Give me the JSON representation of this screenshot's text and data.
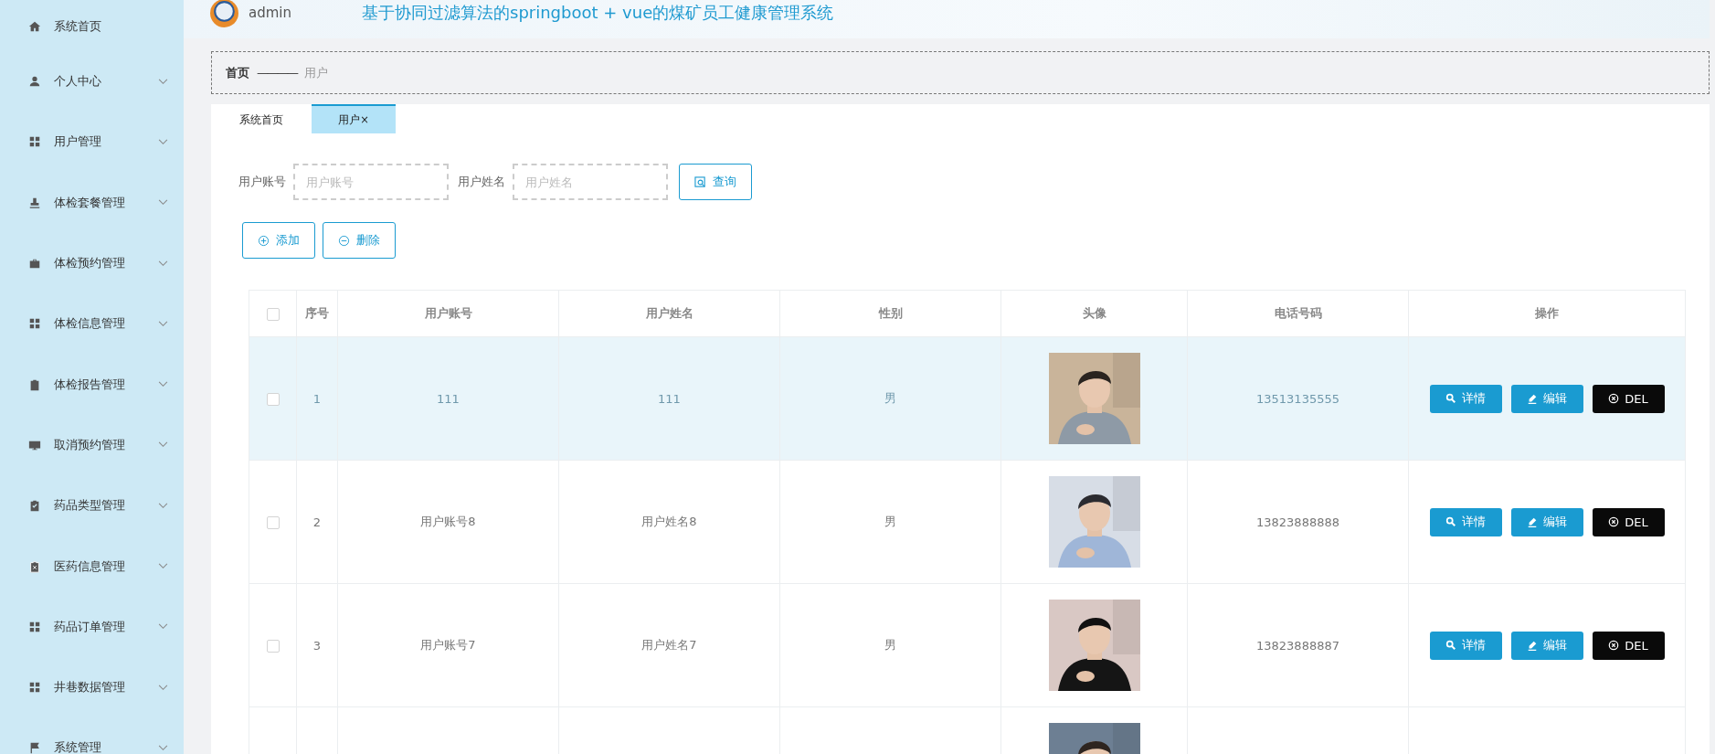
{
  "header": {
    "user": "admin",
    "title": "基于协同过滤算法的springboot + vue的煤矿员工健康管理系统"
  },
  "sidebar": {
    "items": [
      {
        "label": "系统首页",
        "expandable": false
      },
      {
        "label": "个人中心",
        "expandable": true
      },
      {
        "label": "用户管理",
        "expandable": true
      },
      {
        "label": "体检套餐管理",
        "expandable": true
      },
      {
        "label": "体检预约管理",
        "expandable": true
      },
      {
        "label": "体检信息管理",
        "expandable": true
      },
      {
        "label": "体检报告管理",
        "expandable": true
      },
      {
        "label": "取消预约管理",
        "expandable": true
      },
      {
        "label": "药品类型管理",
        "expandable": true
      },
      {
        "label": "医药信息管理",
        "expandable": true
      },
      {
        "label": "药品订单管理",
        "expandable": true
      },
      {
        "label": "井巷数据管理",
        "expandable": true
      },
      {
        "label": "系统管理",
        "expandable": true
      }
    ]
  },
  "breadcrumb": {
    "home": "首页",
    "separator": "————",
    "current": "用户"
  },
  "tabs": [
    {
      "label": "系统首页",
      "selected": false
    },
    {
      "label": "用户×",
      "selected": true
    }
  ],
  "search": {
    "fields": [
      {
        "label": "用户账号",
        "placeholder": "用户账号"
      },
      {
        "label": "用户姓名",
        "placeholder": "用户姓名"
      }
    ],
    "button": "查询"
  },
  "toolbar": [
    {
      "label": "添加",
      "kind": "add"
    },
    {
      "label": "删除",
      "kind": "remove"
    }
  ],
  "table": {
    "header_checked": false,
    "columns": [
      "序号",
      "用户账号",
      "用户姓名",
      "性别",
      "头像",
      "电话号码",
      "操作"
    ],
    "rows": [
      {
        "checked": false,
        "highlighted": true,
        "index": "1",
        "account": "111",
        "name": "111",
        "gender": "男",
        "phone": "13513135555",
        "actions": [
          {
            "label": "详情",
            "kind": "detail"
          },
          {
            "label": "编辑",
            "kind": "edit"
          },
          {
            "label": "DEL",
            "kind": "delete"
          }
        ]
      },
      {
        "checked": false,
        "highlighted": false,
        "index": "2",
        "account": "用户账号8",
        "name": "用户姓名8",
        "gender": "男",
        "phone": "13823888888",
        "actions": [
          {
            "label": "详情",
            "kind": "detail"
          },
          {
            "label": "编辑",
            "kind": "edit"
          },
          {
            "label": "DEL",
            "kind": "delete"
          }
        ]
      },
      {
        "checked": false,
        "highlighted": false,
        "index": "3",
        "account": "用户账号7",
        "name": "用户姓名7",
        "gender": "男",
        "phone": "13823888887",
        "actions": [
          {
            "label": "详情",
            "kind": "detail"
          },
          {
            "label": "编辑",
            "kind": "edit"
          },
          {
            "label": "DEL",
            "kind": "delete"
          }
        ]
      },
      {
        "highlighted": false
      }
    ]
  }
}
